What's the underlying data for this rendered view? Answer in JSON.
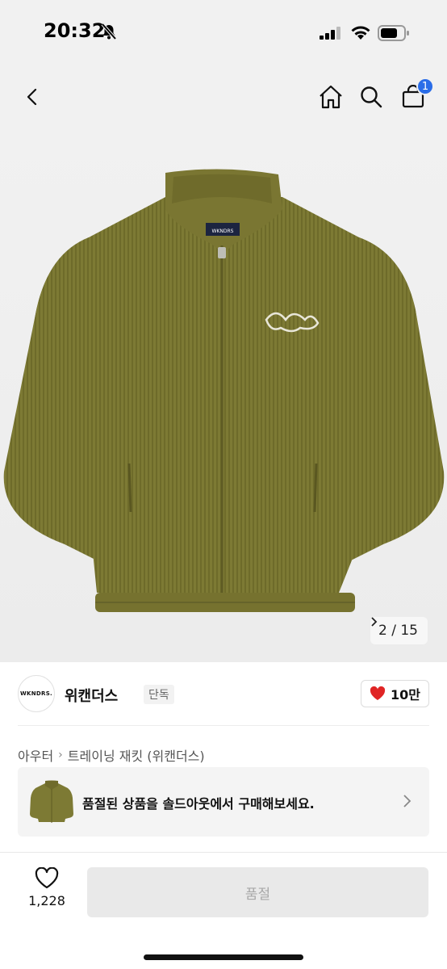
{
  "status_bar": {
    "time": "20:32"
  },
  "nav": {
    "cart_count": "1"
  },
  "hero": {
    "page_indicator": "2 / 15",
    "label_tag": "WKNDRS"
  },
  "brand": {
    "logo_text": "WKNDRS.",
    "name": "위캔더스",
    "tag": "단독",
    "likes": "10만"
  },
  "breadcrumb": {
    "category": "아우터",
    "subcategory": "트레이닝 재킷 (위캔더스)"
  },
  "soldout_banner": {
    "text": "품절된 상품을 솔드아웃에서 구매해보세요."
  },
  "bottom_bar": {
    "wish_count": "1,228",
    "soldout_label": "품절"
  },
  "colors": {
    "accent_blue": "#2a6de8",
    "heart_red": "#e02525",
    "jacket_olive": "#7d7a34"
  }
}
